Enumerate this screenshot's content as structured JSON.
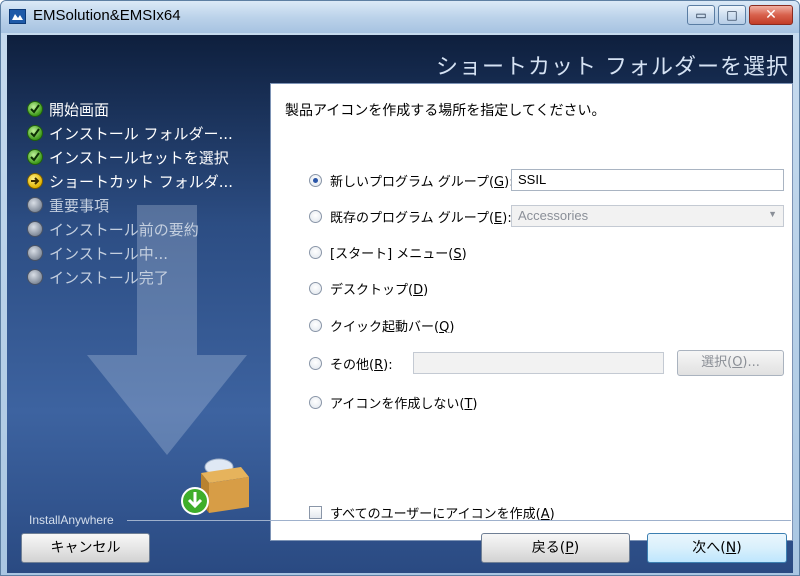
{
  "window": {
    "title": "EMSolution&EMSIx64",
    "controls": {
      "minimize_glyph": "▭",
      "maximize_glyph": "□",
      "close_glyph": "✕"
    }
  },
  "header": {
    "title": "ショートカット フォルダーを選択"
  },
  "steps": [
    {
      "label": "開始画面",
      "status": "done"
    },
    {
      "label": "インストール フォルダー...",
      "status": "done"
    },
    {
      "label": "インストールセットを選択",
      "status": "done"
    },
    {
      "label": "ショートカット フォルダ...",
      "status": "current"
    },
    {
      "label": "重要事項",
      "status": "pending"
    },
    {
      "label": "インストール前の要約",
      "status": "pending"
    },
    {
      "label": "インストール中...",
      "status": "pending"
    },
    {
      "label": "インストール完了",
      "status": "pending"
    }
  ],
  "panel": {
    "instruction": "製品アイコンを作成する場所を指定してください。",
    "options": {
      "new_group": {
        "label": "新しいプログラム グループ(",
        "key": "G",
        "suffix": "):",
        "selected": true
      },
      "existing_group": {
        "label": "既存のプログラム グループ(",
        "key": "E",
        "suffix": "):",
        "selected": false
      },
      "start_menu": {
        "label": "[スタート] メニュー(",
        "key": "S",
        "suffix": ")",
        "selected": false
      },
      "desktop": {
        "label": "デスクトップ(",
        "key": "D",
        "suffix": ")",
        "selected": false
      },
      "quick_launch": {
        "label": "クイック起動バー(",
        "key": "Q",
        "suffix": ")",
        "selected": false
      },
      "other": {
        "label": "その他(",
        "key": "R",
        "suffix": "):",
        "selected": false
      },
      "none": {
        "label": "アイコンを作成しない(",
        "key": "T",
        "suffix": ")",
        "selected": false
      }
    },
    "new_group_value": "SSIL",
    "existing_group_value": "Accessories",
    "other_path_value": "",
    "browse_button": {
      "label": "選択(",
      "key": "O",
      "suffix": ")..."
    },
    "all_users": {
      "label": "すべてのユーザーにアイコンを作成(",
      "key": "A",
      "suffix": ")",
      "checked": false
    }
  },
  "footer": {
    "brand": "InstallAnywhere",
    "cancel": "キャンセル",
    "back": {
      "label": "戻る(",
      "key": "P",
      "suffix": ")"
    },
    "next": {
      "label": "次へ(",
      "key": "N",
      "suffix": ")"
    }
  }
}
